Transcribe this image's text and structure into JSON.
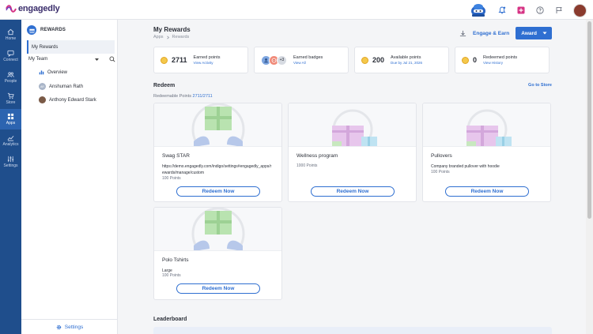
{
  "app": {
    "logo_text": "engagedly"
  },
  "left_nav": [
    {
      "label": "Home",
      "icon": "home-icon"
    },
    {
      "label": "Connect",
      "icon": "connect-icon"
    },
    {
      "label": "People",
      "icon": "people-icon"
    },
    {
      "label": "Store",
      "icon": "store-icon"
    },
    {
      "label": "Apps",
      "icon": "apps-icon",
      "active": true
    },
    {
      "label": "Analytics",
      "icon": "analytics-icon"
    },
    {
      "label": "Settings",
      "icon": "settings-icon"
    }
  ],
  "sidebar": {
    "header": "REWARDS",
    "my_rewards": "My Rewards",
    "team_select": "My Team",
    "items": [
      {
        "label": "Overview"
      },
      {
        "label": "Anshuman Rath",
        "initials": "AR"
      },
      {
        "label": "Anthony Edward Stark"
      }
    ],
    "settings": "Settings"
  },
  "header": {
    "title": "My Rewards",
    "breadcrumb": [
      "Apps",
      "Rewards"
    ],
    "engage_earn": "Engage & Earn",
    "award": "Award"
  },
  "stats": {
    "earned_points": {
      "value": "2711",
      "label": "Earned points",
      "link": "View Activity"
    },
    "earned_badges": {
      "more": "+3",
      "label": "Earned badges",
      "link": "View All"
    },
    "available_points": {
      "value": "200",
      "label": "Available points",
      "link": "Due by Jul 21, 2026"
    },
    "redeemed_points": {
      "value": "0",
      "label": "Redeemed points",
      "link": "View History"
    }
  },
  "redeem": {
    "title": "Redeem",
    "go_to_store": "Go to Store",
    "redeemable_label": "Redeemable Points",
    "redeemable_value": "2711/2711",
    "cards": [
      {
        "title": "Swag STAR",
        "desc": "https://demo.engagedly.com/indigo/settings#engagedly_apps/rewards/manage/custom",
        "points": "100 Points",
        "button": "Redeem Now"
      },
      {
        "title": "Wellness program",
        "desc": "",
        "points": "1000 Points",
        "button": "Redeem Now"
      },
      {
        "title": "Pullovers",
        "desc": "Company branded pullover with hoodie",
        "points": "100 Points",
        "button": "Redeem Now"
      },
      {
        "title": "Polo Tshirts",
        "desc": "Large",
        "points": "100 Points",
        "button": "Redeem Now"
      }
    ]
  },
  "leaderboard": {
    "title": "Leaderboard"
  },
  "colors": {
    "primary": "#2f6fd1",
    "nav": "#1f4e8c",
    "coin": "#f4c84b"
  }
}
